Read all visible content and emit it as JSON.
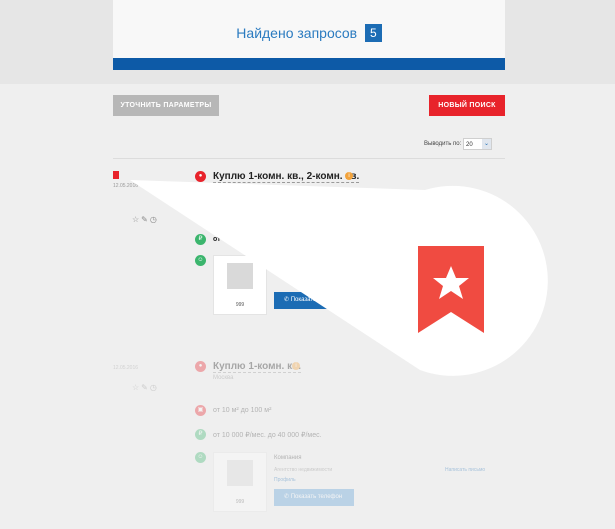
{
  "results": {
    "found_label": "Найдено запросов",
    "count": "5"
  },
  "toolbar": {
    "refine_label": "УТОЧНИТЬ ПАРАМЕТРЫ",
    "new_search_label": "НОВЫЙ ПОИСК"
  },
  "perpage": {
    "label": "Выводить по:",
    "value": "20"
  },
  "card1": {
    "date": "12.05.2016",
    "title": "Куплю 1-комн. кв., 2-комн. кв.",
    "subtitle": "Москва",
    "price_from": "от",
    "image_id": "999",
    "phone_button": "Показать"
  },
  "card2": {
    "date": "12.05.2016",
    "title": "Куплю 1-комн. кв.",
    "subtitle": "Москва",
    "area": "от 10 м² до 100 м²",
    "price": "от 10 000 ₽/мес. до 40 000 ₽/мес.",
    "owner_type": "Компания",
    "owner_note": "Агентство недвижимости",
    "owner_link": "Профиль",
    "image_id": "999",
    "phone_button": "Показать телефон",
    "compare_link": "Написать письмо"
  },
  "colors": {
    "accent": "#e8232b",
    "primary": "#1c6cb4",
    "bar": "#0d5aa7"
  }
}
